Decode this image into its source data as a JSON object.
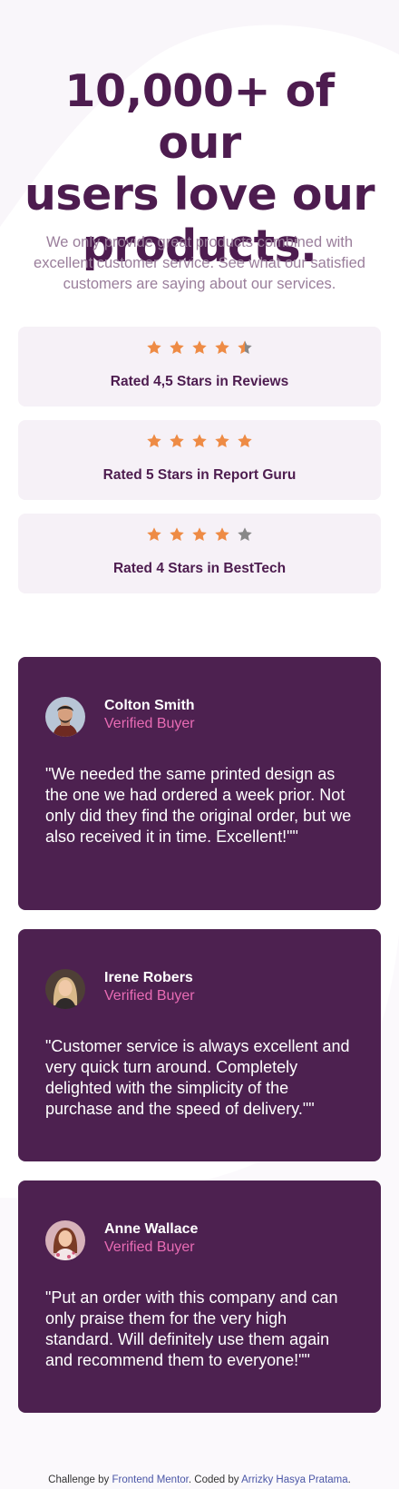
{
  "colors": {
    "heading": "#4d1c4f",
    "body_text": "#9a7e9b",
    "card_bg": "#f6f1f7",
    "testimonial_bg": "#4d2150",
    "star": "#ee8b45",
    "star_empty": "#888888",
    "accent_pink": "#e86bb4",
    "link": "#4a56a6"
  },
  "hero": {
    "title_line1": "10,000+ of our",
    "title_line2": "users love our",
    "title_line3": "products.",
    "description": "We only provide great products combined with excellent customer service. See what our satisfied customers are saying about our services."
  },
  "ratings": [
    {
      "label": "Rated 4,5 Stars in Reviews",
      "stars": 4.5,
      "max": 5
    },
    {
      "label": "Rated 5 Stars in Report Guru",
      "stars": 5,
      "max": 5
    },
    {
      "label": "Rated 4 Stars in BestTech",
      "stars": 4,
      "max": 5
    }
  ],
  "testimonials": [
    {
      "name": "Colton Smith",
      "role": "Verified Buyer",
      "avatar_icon": "man-avatar",
      "quote": "\"We needed the same printed design as the one we had ordered a week prior. Not only did they find the original order, but we also received it in time. Excellent!\"\""
    },
    {
      "name": "Irene Robers",
      "role": "Verified Buyer",
      "avatar_icon": "woman-avatar",
      "quote": "\"Customer service is always excellent and very quick turn around. Completely delighted with the simplicity of the purchase and the speed of delivery.\"\""
    },
    {
      "name": "Anne Wallace",
      "role": "Verified Buyer",
      "avatar_icon": "woman-avatar",
      "quote": "\"Put an order with this company and can only praise them for the very high standard. Will definitely use them again and recommend them to everyone!\"\""
    }
  ],
  "footer": {
    "challenge_by": "Challenge by",
    "challenge_link": "Frontend Mentor",
    "coded_by": ". Coded by",
    "author_link": "Arrizky Hasya Pratama",
    "end": "."
  }
}
